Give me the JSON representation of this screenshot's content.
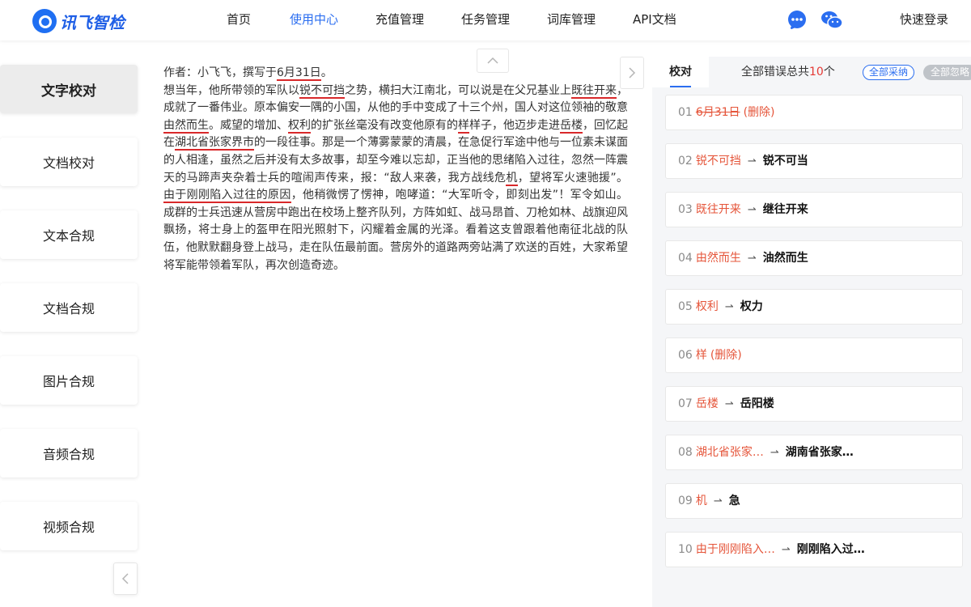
{
  "header": {
    "logo_text": "讯飞智检",
    "nav": [
      "首页",
      "使用中心",
      "充值管理",
      "任务管理",
      "词库管理",
      "API文档"
    ],
    "active_nav": "使用中心",
    "login": "快速登录",
    "accent_color": "#2b6ef0"
  },
  "sidebar": {
    "items": [
      "文字校对",
      "文档校对",
      "文本合规",
      "文档合规",
      "图片合规",
      "音频合规",
      "视频合规"
    ],
    "active": "文字校对"
  },
  "editor": {
    "segments": [
      {
        "t": "作者：小飞飞，撰写于"
      },
      {
        "t": "6月31日",
        "e": 1
      },
      {
        "t": "。"
      },
      {
        "br": 1
      },
      {
        "t": "想当年，他所带领的军队以"
      },
      {
        "t": "锐不可挡",
        "e": 1
      },
      {
        "t": "之势，横扫大江南北，可以说是在父兄基业上"
      },
      {
        "t": "既往开来",
        "e": 1
      },
      {
        "t": "，成就了一番伟业。原本偏安一隅的小国，从他的手中变成了十三个州，国人对这位领袖的敬意"
      },
      {
        "t": "由然而生",
        "e": 1
      },
      {
        "t": "。威望的增加、"
      },
      {
        "t": "权利",
        "e": 1
      },
      {
        "t": "的扩张丝毫没有改变他原有的"
      },
      {
        "t": "样",
        "e": 1
      },
      {
        "t": "样子，他迈步走进"
      },
      {
        "t": "岳楼",
        "e": 1
      },
      {
        "t": "，回忆起在"
      },
      {
        "t": "湖北省张家界市",
        "e": 1
      },
      {
        "t": "的一段往事。那是一个薄雾蒙蒙的清晨，在急促行军途中他与一位素未谋面的人相逢，虽然之后并没有太多故事，却至今难以忘却，正当他的思绪陷入过往，忽然一阵震天的马蹄声夹杂着士兵的喧闹声传来，报：“敌人来袭，我方战线危"
      },
      {
        "t": "机",
        "e": 1
      },
      {
        "t": "，望将军火速驰援”。"
      },
      {
        "t": "由于刚刚陷入过往的原因",
        "e": 1
      },
      {
        "t": "，他稍微愣了愣神，咆哮道：“大军听令，即刻出发”！军令如山。成群的士兵迅速从营房中跑出在校场上整齐队列，方阵如虹、战马昂首、刀枪如林、战旗迎风飘扬，将士身上的盔甲在阳光照射下，闪耀着金属的光泽。看着这支曾跟着他南征北战的队伍，他默默翻身登上战马，走在队伍最前面。营房外的道路两旁站满了欢送的百姓，大家希望将军能带领着军队，再次创造奇迹。"
      }
    ]
  },
  "panel": {
    "tab": "校对",
    "total_prefix": "全部错误总共",
    "total_count": "10",
    "total_suffix": "个",
    "accept_all": "全部采纳",
    "ignore_all": "全部忽略",
    "error_color": "#e5553a",
    "corrections": [
      {
        "no": "01",
        "wrong": "6月31日",
        "right": "",
        "delete": "(删除)",
        "strike": true
      },
      {
        "no": "02",
        "wrong": "锐不可挡",
        "right": "锐不可当"
      },
      {
        "no": "03",
        "wrong": "既往开来",
        "right": "继往开来"
      },
      {
        "no": "04",
        "wrong": "由然而生",
        "right": "油然而生"
      },
      {
        "no": "05",
        "wrong": "权利",
        "right": "权力"
      },
      {
        "no": "06",
        "wrong": "样",
        "right": "",
        "delete": "(删除)"
      },
      {
        "no": "07",
        "wrong": "岳楼",
        "right": "岳阳楼"
      },
      {
        "no": "08",
        "wrong": "湖北省张家…",
        "right": "湖南省张家…"
      },
      {
        "no": "09",
        "wrong": "机",
        "right": "急"
      },
      {
        "no": "10",
        "wrong": "由于刚刚陷入…",
        "right": "刚刚陷入过…"
      }
    ]
  }
}
